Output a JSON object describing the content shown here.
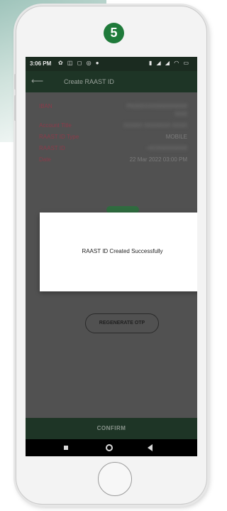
{
  "step_badge": "5",
  "status_bar": {
    "time": "3:06 PM",
    "left_icons": "✿ ◫ ◻ ◎ ●",
    "right_icons": "▮ ◢ ◢ ◠ ▭"
  },
  "app_bar": {
    "back_icon": "arrow-left-icon",
    "title": "Create RAAST ID"
  },
  "details": [
    {
      "label": "IBAN",
      "value": "PK00XXXX0000000000",
      "value2": "0000",
      "blurred": true
    },
    {
      "label": "Account Title",
      "value": "XXXXX XXXXXXX XXXX",
      "blurred": true
    },
    {
      "label": "RAAST ID Type",
      "value": "MOBILE",
      "blurred": false
    },
    {
      "label": "RAAST ID",
      "value": "+923000000000",
      "blurred": true
    },
    {
      "label": "Date",
      "value": "22 Mar 2022 03:00 PM",
      "blurred": false
    }
  ],
  "dialog": {
    "message": "RAAST ID Created Successfully"
  },
  "regenerate_button": "REGENERATE OTP",
  "confirm_button": "CONFIRM",
  "colors": {
    "badge": "#1f7a3a",
    "app_bar": "#1e3526",
    "label": "#8c3b4a",
    "overlay": "#515151"
  }
}
